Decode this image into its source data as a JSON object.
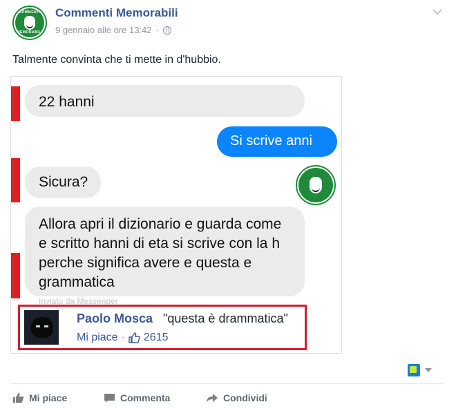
{
  "post": {
    "page_name": "Commenti Memorabili",
    "timestamp": "9 gennaio alle ore 13:42",
    "meta_separator": "·",
    "text": "Talmente convinta che ti mette in d'hubbio."
  },
  "logo": {
    "top_text": "COMMENTI",
    "bottom_text": "MEMORABILI"
  },
  "chat": {
    "msg1": "22 hanni",
    "msg2": "Si scrive anni",
    "msg3": "Sicura?",
    "msg4": "Allora apri il dizionario e guarda come e scritto hanni di eta si scrive con la h perche significa avere e questa e grammatica",
    "sent_via": "Inviato da Messenger"
  },
  "comment": {
    "author": "Paolo Mosca",
    "text": "\"questa è drammatica\"",
    "like_label": "Mi piace",
    "separator": "·",
    "like_count": "2615"
  },
  "actions": {
    "like": "Mi piace",
    "comment": "Commenta",
    "share": "Condividi"
  },
  "colors": {
    "brand_blue": "#3b5998",
    "messenger_blue": "#0a84ff",
    "highlight_red": "#d0202a",
    "logo_green": "#1e8a3a"
  }
}
